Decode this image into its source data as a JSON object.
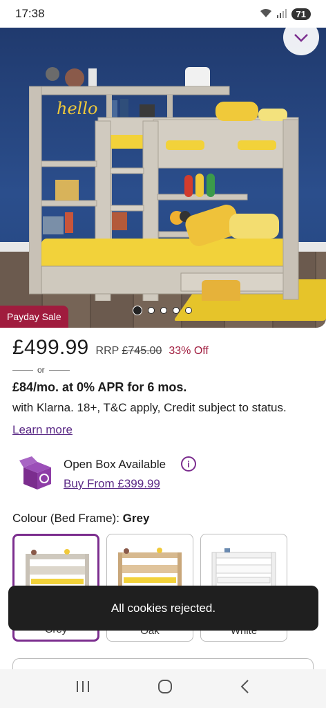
{
  "status_bar": {
    "time": "17:38",
    "battery": "71"
  },
  "hero": {
    "sale_tag": "Payday Sale",
    "carousel_total": 5,
    "carousel_active": 1,
    "hello_sign": "hello"
  },
  "pricing": {
    "price": "£499.99",
    "rrp_label": "RRP",
    "rrp_value": "£745.00",
    "discount": "33% Off",
    "or": "or",
    "klarna_headline": "£84/mo. at 0% APR for 6 mos.",
    "klarna_details": "with Klarna. 18+, T&C apply, Credit subject to status.",
    "learn_more": "Learn more"
  },
  "open_box": {
    "title": "Open Box Available",
    "info": "i",
    "link": "Buy From £399.99"
  },
  "colour": {
    "label": "Colour (Bed Frame): ",
    "selected": "Grey",
    "options": [
      {
        "label": "Grey",
        "selected": true
      },
      {
        "label": "Oak",
        "selected": false
      },
      {
        "label": "White",
        "selected": false
      }
    ]
  },
  "toast": {
    "message": "All cookies rejected."
  },
  "colors": {
    "brand_purple": "#7b2d8e",
    "sale_red": "#a01c3e",
    "toast_bg": "#1f1f1f"
  }
}
